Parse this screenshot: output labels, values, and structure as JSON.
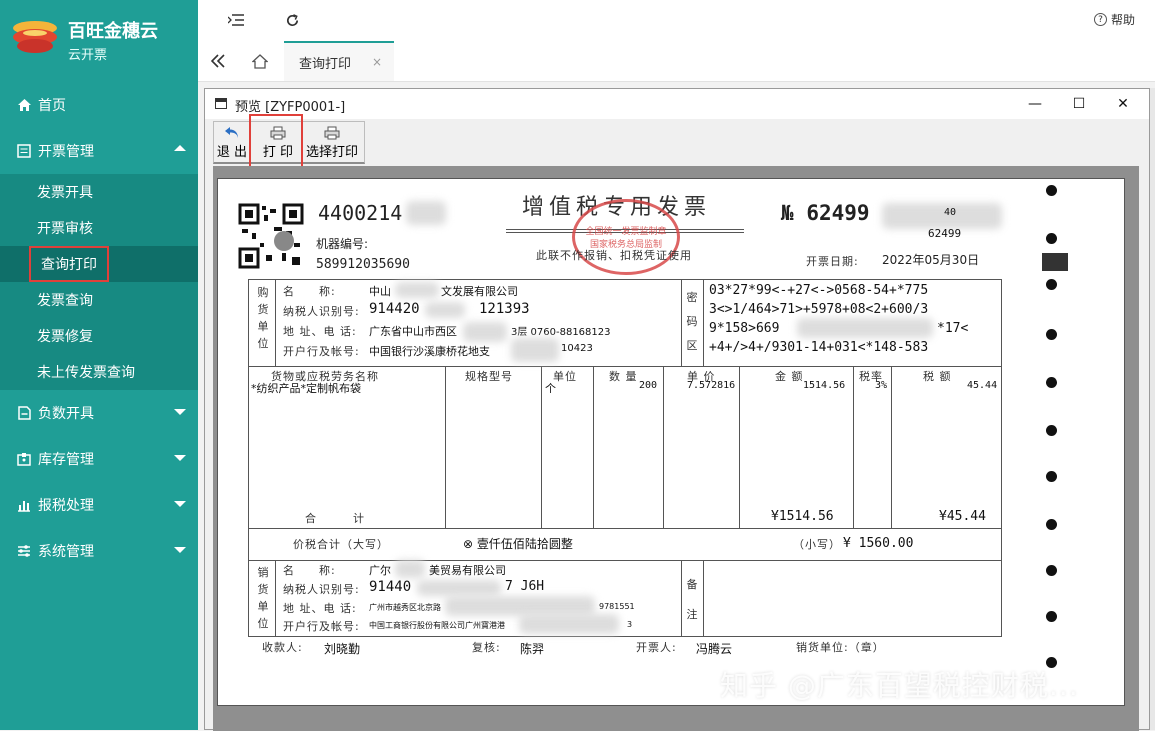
{
  "brand": {
    "title": "百旺金穗云",
    "subtitle": "云开票"
  },
  "sidebar": {
    "items": [
      {
        "label": "首页",
        "icon": "home-icon"
      },
      {
        "label": "开票管理",
        "icon": "invoice-icon",
        "expanded": true,
        "children": [
          "发票开具",
          "开票审核",
          "查询打印",
          "发票查询",
          "发票修复",
          "未上传发票查询"
        ]
      },
      {
        "label": "负数开具",
        "icon": "document-icon"
      },
      {
        "label": "库存管理",
        "icon": "inventory-icon"
      },
      {
        "label": "报税处理",
        "icon": "chart-icon"
      },
      {
        "label": "系统管理",
        "icon": "settings-icon"
      }
    ],
    "active_child": "查询打印"
  },
  "topbar": {
    "help_label": "帮助"
  },
  "tabs": [
    {
      "label": "查询打印",
      "close": "×"
    }
  ],
  "dialog": {
    "title": "预览 [ZYFP0001-]",
    "controls": {
      "minimize": "—",
      "maximize": "☐",
      "close": "✕"
    },
    "toolbar": {
      "exit_label": "退 出",
      "print_label": "打 印",
      "select_print_label": "选择打印"
    }
  },
  "invoice": {
    "title": "增值税专用发票",
    "note": "此联不作报销、扣税凭证使用",
    "stamp_text": [
      "全国统一发票监制章",
      "国家税务总局监制"
    ],
    "code": "4400214",
    "machine_label": "机器编号:",
    "machine_number": "589912035690",
    "number_prefix": "№",
    "number": "62499",
    "number_small_1": "40",
    "number_small_2": "62499",
    "date_label": "开票日期:",
    "date": "2022年05月30日",
    "buyer": {
      "side_label": "购货单位",
      "name_label": "名　　称:",
      "name": "中山",
      "name_tail": "文发展有限公司",
      "tax_label": "纳税人识别号:",
      "tax_id": "914420",
      "tax_id_tail": "121393",
      "addr_label": "地 址、电 话:",
      "addr": "广东省中山市西区",
      "addr_tail": "3层 0760-88168123",
      "bank_label": "开户行及帐号:",
      "bank": "中国银行沙溪康桥花地支",
      "bank_tail": "10423"
    },
    "password_label": "密码区",
    "password_lines": [
      "03*27*99<-+27<->0568-54+*775",
      "3<>1/464>71>+5978+08<2+600/3",
      "9*158>669",
      "*17<",
      "+4+/>4+/9301-14+031<*148-583"
    ],
    "table_headers": [
      "货物或应税劳务名称",
      "规格型号",
      "单位",
      "数 量",
      "单 价",
      "金 额",
      "税率",
      "税 额"
    ],
    "items": [
      {
        "name": "*纺织产品*定制帆布袋",
        "spec": "",
        "unit": "个",
        "qty": "200",
        "price": "7.572816",
        "amount": "1514.56",
        "rate": "3%",
        "tax": "45.44"
      }
    ],
    "total_label": "合　　　计",
    "total_amount": "¥1514.56",
    "total_tax": "¥45.44",
    "grand_label": "价税合计（大写）",
    "grand_upper": "⊗ 壹仟伍佰陆拾圆整",
    "grand_lower_label": "（小写）",
    "grand_lower": "¥ 1560.00",
    "seller": {
      "side_label": "销货单位",
      "name_label": "名　　称:",
      "name": "广尔",
      "name_tail": "美贸易有限公司",
      "tax_label": "纳税人识别号:",
      "tax_id": "91440",
      "tax_id_tail": "7 J6H",
      "addr_label": "地 址、电 话:",
      "addr": "广州市越秀区北京路",
      "addr_tail": "9781551",
      "bank_label": "开户行及帐号:",
      "bank": "中国工商银行股份有限公司广州寶港港",
      "bank_tail": "3"
    },
    "remark_label": "备注",
    "payee_label": "收款人:",
    "payee": "刘晓勤",
    "reviewer_label": "复核:",
    "reviewer": "陈羿",
    "drawer_label": "开票人:",
    "drawer": "冯腾云",
    "seal_label": "销货单位:（章）"
  },
  "watermark": "知乎 @广东百望税控财税..."
}
